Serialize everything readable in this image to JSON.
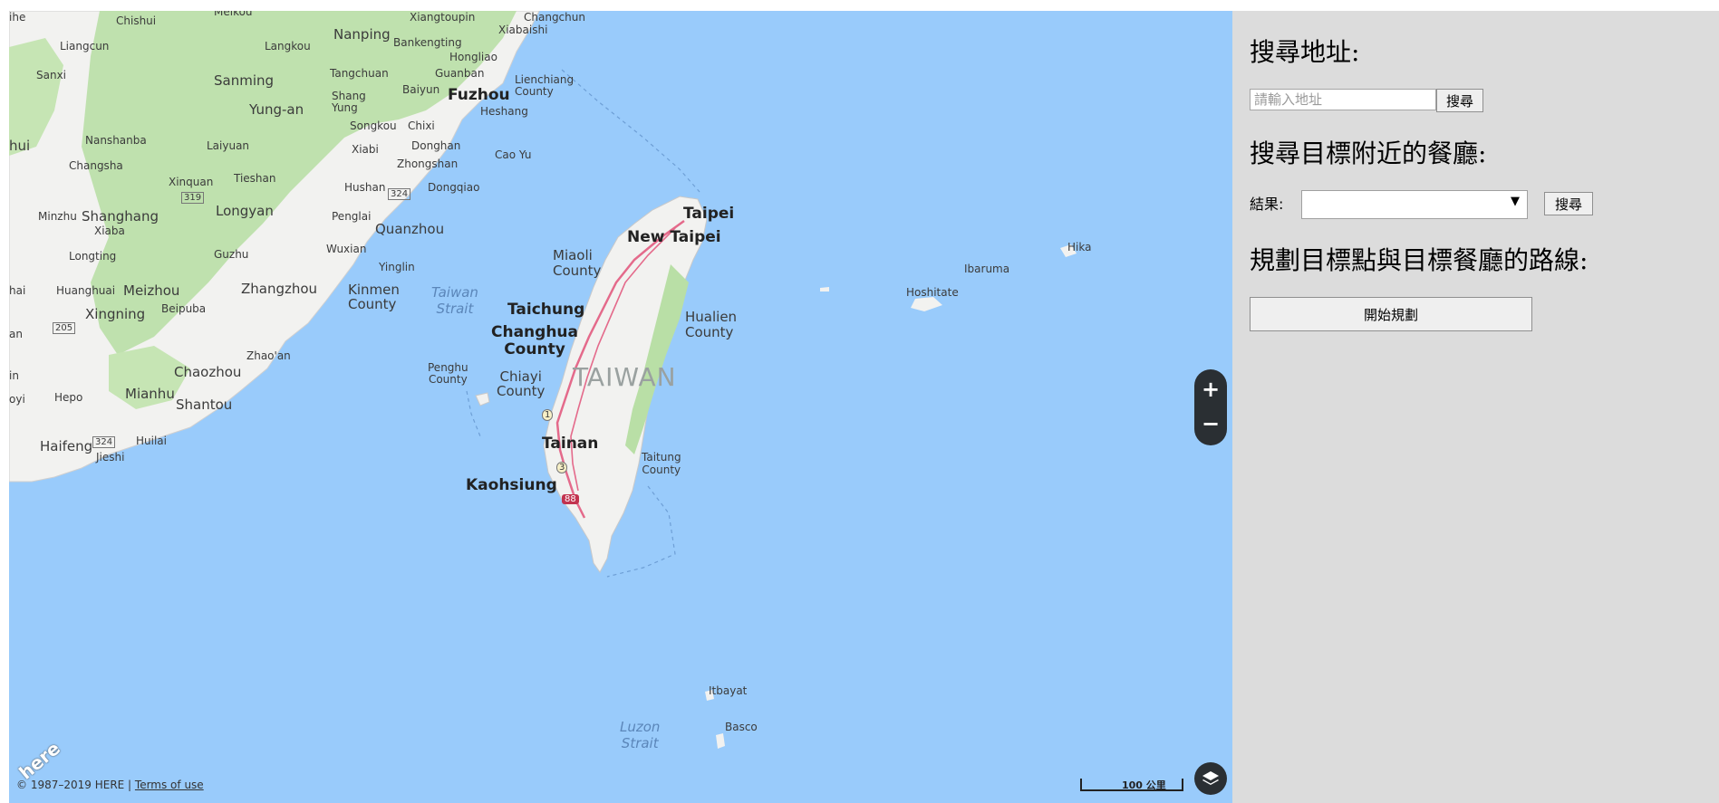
{
  "map": {
    "labels": {
      "ihe": "ihe",
      "chishui": "Chishui",
      "meikou": "Meikou",
      "xiangtoupin": "Xiangtoupin",
      "changchun": "Changchun",
      "liangcun": "Liangcun",
      "langkou": "Langkou",
      "nanping": "Nanping",
      "bankengting": "Bankengting",
      "xiabaishi": "Xiabaishi",
      "sanxi": "Sanxi",
      "sanming": "Sanming",
      "tangchuan": "Tangchuan",
      "guanban": "Guanban",
      "hongliao": "Hongliao",
      "lienchiang": "Lienchiang\nCounty",
      "baiyun": "Baiyun",
      "fuzhou": "Fuzhou",
      "yungan": "Yung-an",
      "shangyung": "Shang\nYung",
      "heshang": "Heshang",
      "nanshanba": "Nanshanba",
      "songkou": "Songkou",
      "chixi": "Chixi",
      "hui": "hui",
      "laiyuan": "Laiyuan",
      "xiabi": "Xiabi",
      "donghan": "Donghan",
      "caoyu": "Cao Yu",
      "changsha": "Changsha",
      "zhongshan": "Zhongshan",
      "xinquan": "Xinquan",
      "tieshan": "Tieshan",
      "hushan": "Hushan",
      "dongqiao": "Dongqiao",
      "shield319": "319",
      "shield324": "324",
      "longyan": "Longyan",
      "minzhu": "Minzhu",
      "shanghang": "Shanghang",
      "xiaba": "Xiaba",
      "penglai": "Penglai",
      "quanzhou": "Quanzhou",
      "taipei": "Taipei",
      "newtaipei": "New Taipei",
      "guzhu": "Guzhu",
      "wuxian": "Wuxian",
      "longtiao": "Longting",
      "yinglin": "Yinglin",
      "hika": "Hika",
      "miaoli": "Miaoli\nCounty",
      "ibaruma": "Ibaruma",
      "hai": "hai",
      "huanghuai": "Huanghuai",
      "meizhou": "Meizhou",
      "zhangzhou": "Zhangzhou",
      "kinmen": "Kinmen\nCounty",
      "taiwanstrait": "Taiwan\nStrait",
      "hoshitate": "Hoshitate",
      "xingning": "Xingning",
      "beipuba": "Beipuba",
      "taichung": "Taichung",
      "hualien": "Hualien\nCounty",
      "shield205": "205",
      "changhua": "Changhua\nCounty",
      "an": "an",
      "zhaoan": "Zhao'an",
      "chaozhou": "Chaozhou",
      "penghu": "Penghu\nCounty",
      "chiayi": "Chiayi\nCounty",
      "taiwan": "TAIWAN",
      "in": "in",
      "hepo": "Hepo",
      "mianhu": "Mianhu",
      "shantou": "Shantou",
      "oyi": "oyi",
      "haifeng": "Haifeng",
      "shield324b": "324",
      "huilai": "Huilai",
      "jieshi": "Jieshi",
      "tainan": "Tainan",
      "taitung": "Taitung\nCounty",
      "kaohsiung": "Kaohsiung",
      "shield88": "88",
      "shield3": "3",
      "shield1": "1",
      "itbayat": "Itbayat",
      "basco": "Basco",
      "luzonstrait": "Luzon\nStrait"
    },
    "zoom_in_label": "+",
    "zoom_out_label": "−",
    "scale_label": "100 公里",
    "copyright_text": "© 1987–2019 HERE | ",
    "terms_link": "Terms of use",
    "logo_text": "here"
  },
  "panel": {
    "search_address_heading": "搜尋地址:",
    "address_placeholder": "請輸入地址",
    "search_button_1": "搜尋",
    "nearby_heading": "搜尋目標附近的餐廳:",
    "result_label": "結果:",
    "result_selected": "",
    "search_button_2": "搜尋",
    "route_heading": "規劃目標點與目標餐廳的路線:",
    "start_button": "開始規劃"
  },
  "colors": {
    "water": "#99cbfb",
    "land": "#f2f2f0",
    "forest": "#b9dfa6",
    "panel_bg": "#dcdcdc",
    "control_bg": "#2a2f33",
    "road": "#e46a8b"
  }
}
